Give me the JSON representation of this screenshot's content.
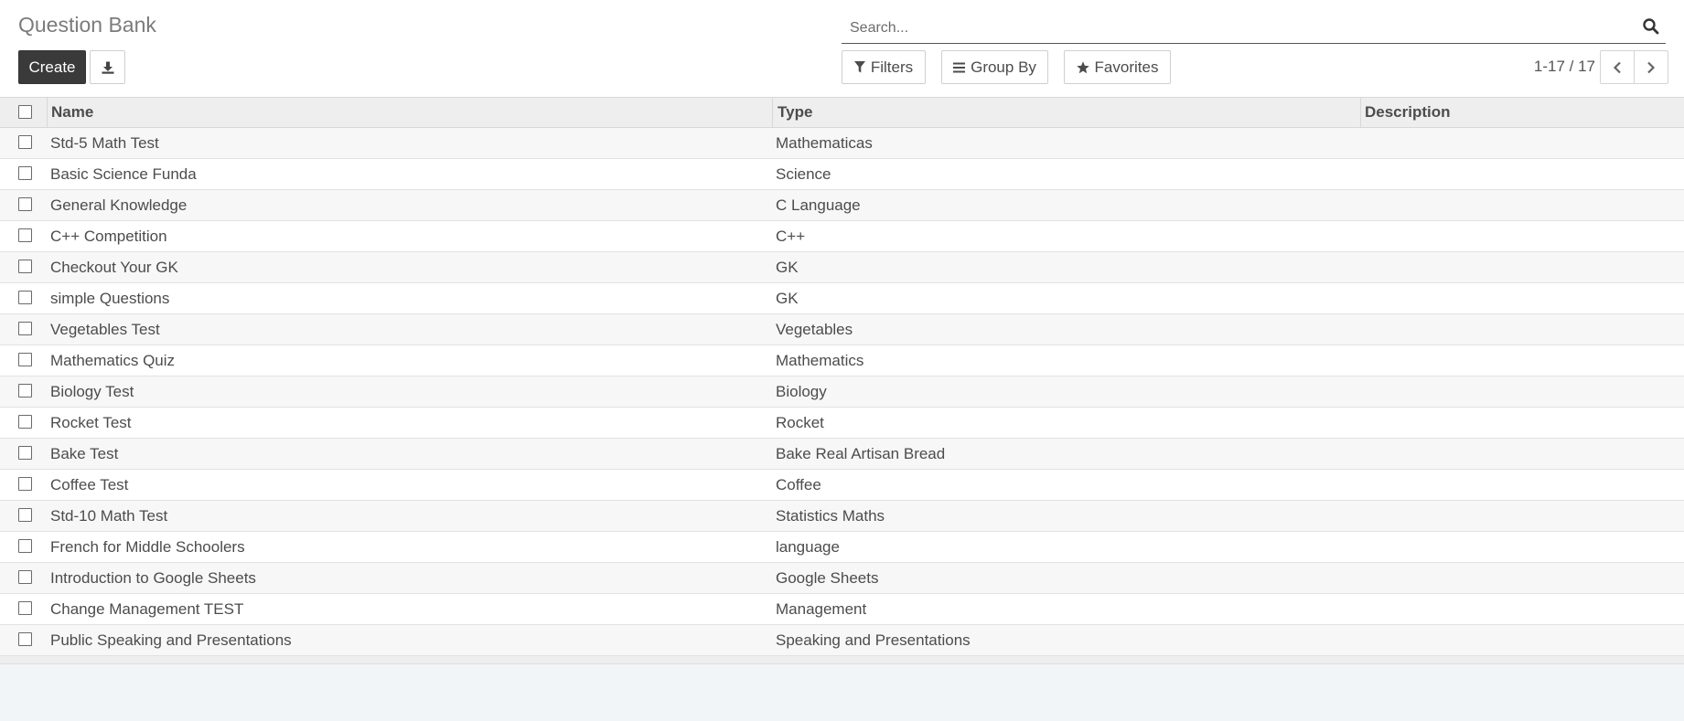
{
  "header": {
    "title": "Question Bank",
    "create_label": "Create",
    "download_icon": "download-icon"
  },
  "search": {
    "placeholder": "Search...",
    "value": "",
    "icon": "search-icon"
  },
  "filters": {
    "filters_label": "Filters",
    "group_by_label": "Group By",
    "favorites_label": "Favorites"
  },
  "pager": {
    "value": "1-17 / 17"
  },
  "table": {
    "columns": [
      "Name",
      "Type",
      "Description"
    ],
    "rows": [
      {
        "name": "Std-5 Math Test",
        "type": "Mathematicas",
        "description": ""
      },
      {
        "name": "Basic Science Funda",
        "type": "Science",
        "description": ""
      },
      {
        "name": "General Knowledge",
        "type": "C Language",
        "description": ""
      },
      {
        "name": "C++ Competition",
        "type": "C++",
        "description": ""
      },
      {
        "name": "Checkout Your GK",
        "type": "GK",
        "description": ""
      },
      {
        "name": "simple Questions",
        "type": "GK",
        "description": ""
      },
      {
        "name": "Vegetables Test",
        "type": "Vegetables",
        "description": ""
      },
      {
        "name": "Mathematics Quiz",
        "type": "Mathematics",
        "description": ""
      },
      {
        "name": "Biology Test",
        "type": "Biology",
        "description": ""
      },
      {
        "name": "Rocket Test",
        "type": "Rocket",
        "description": ""
      },
      {
        "name": "Bake Test",
        "type": "Bake Real Artisan Bread",
        "description": ""
      },
      {
        "name": "Coffee Test",
        "type": "Coffee",
        "description": ""
      },
      {
        "name": "Std-10 Math Test",
        "type": "Statistics Maths",
        "description": ""
      },
      {
        "name": "French for Middle Schoolers",
        "type": "language",
        "description": ""
      },
      {
        "name": "Introduction to Google Sheets",
        "type": "Google Sheets",
        "description": ""
      },
      {
        "name": "Change Management TEST",
        "type": "Management",
        "description": ""
      },
      {
        "name": "Public Speaking and Presentations",
        "type": "Speaking and Presentations",
        "description": ""
      }
    ]
  }
}
